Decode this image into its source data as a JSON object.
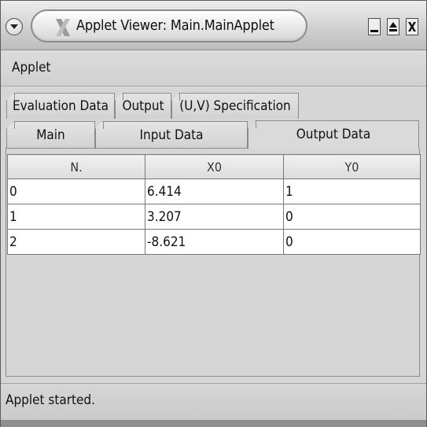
{
  "window": {
    "title": "Applet Viewer: Main.MainApplet"
  },
  "menubar": {
    "applet_label": "Applet"
  },
  "tabs_row1": [
    {
      "label": "Evaluation Data"
    },
    {
      "label": "Output"
    },
    {
      "label": "(U,V) Specification"
    }
  ],
  "tabs_row2": [
    {
      "label": "Main"
    },
    {
      "label": "Input Data"
    },
    {
      "label": "Output Data",
      "selected": true
    }
  ],
  "table": {
    "headers": [
      "N.",
      "X0",
      "Y0"
    ],
    "rows": [
      [
        "0",
        "6.414",
        "1"
      ],
      [
        "1",
        "3.207",
        "0"
      ],
      [
        "2",
        "-8.621",
        "0"
      ]
    ]
  },
  "status": {
    "text": "Applet started."
  },
  "icons": {
    "window_menu": "chevron-down-icon",
    "app": "x-logo-icon",
    "minimize": "minimize-icon",
    "maximize": "maximize-icon",
    "close": "close-icon"
  }
}
